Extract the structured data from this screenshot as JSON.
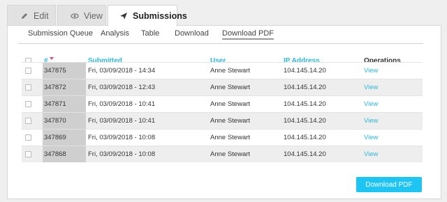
{
  "tabs": [
    {
      "label": "Edit",
      "icon": "pencil-icon"
    },
    {
      "label": "View",
      "icon": "eye-icon"
    },
    {
      "label": "Submissions",
      "icon": "paper-plane-icon",
      "active": true
    }
  ],
  "subnav": [
    "Submission Queue",
    "Analysis",
    "Table",
    "Download",
    "Download PDF"
  ],
  "subnav_active": "Download PDF",
  "table": {
    "headers": {
      "id": "#",
      "submitted": "Submitted",
      "user": "User",
      "ip": "IP Address",
      "operations": "Operations"
    },
    "rows": [
      {
        "id": "347875",
        "submitted": "Fri, 03/09/2018 - 14:34",
        "user": "Anne Stewart",
        "ip": "104.145.14.20",
        "op": "View"
      },
      {
        "id": "347872",
        "submitted": "Fri, 03/09/2018 - 12:43",
        "user": "Anne Stewart",
        "ip": "104.145.14.20",
        "op": "View"
      },
      {
        "id": "347871",
        "submitted": "Fri, 03/09/2018 - 10:41",
        "user": "Anne Stewart",
        "ip": "104.145.14.20",
        "op": "View"
      },
      {
        "id": "347870",
        "submitted": "Fri, 03/09/2018 - 10:41",
        "user": "Anne Stewart",
        "ip": "104.145.14.20",
        "op": "View"
      },
      {
        "id": "347869",
        "submitted": "Fri, 03/09/2018 - 10:08",
        "user": "Anne Stewart",
        "ip": "104.145.14.20",
        "op": "View"
      },
      {
        "id": "347868",
        "submitted": "Fri, 03/09/2018 - 10:08",
        "user": "Anne Stewart",
        "ip": "104.145.14.20",
        "op": "View"
      }
    ]
  },
  "download_button": "Download PDF",
  "colors": {
    "accent": "#2eb8d8",
    "button": "#1fc5f2",
    "sort_arrow": "#d04a7a"
  }
}
